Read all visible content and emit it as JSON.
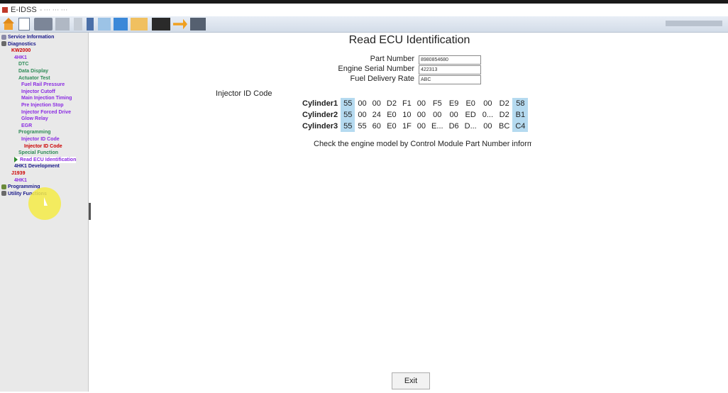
{
  "window": {
    "title": "E-IDSS",
    "title_suffix": "- ··· ··· ···"
  },
  "sidebar": {
    "items": [
      {
        "label": "Service Information",
        "color": "#1a1a8a"
      },
      {
        "label": "Diagnostics",
        "color": "#1a1a8a"
      },
      {
        "label": "KW2000",
        "color": "#cc0000"
      },
      {
        "label": "4HK1",
        "color": "#8a2be2"
      },
      {
        "label": "DTC",
        "color": "#2e8b57"
      },
      {
        "label": "Data Display",
        "color": "#2e8b57"
      },
      {
        "label": "Actuator Test",
        "color": "#2e8b57"
      },
      {
        "label": "Fuel Rail Pressure",
        "color": "#8a2be2"
      },
      {
        "label": "Injector Cutoff",
        "color": "#8a2be2"
      },
      {
        "label": "Main Injection Timing",
        "color": "#8a2be2"
      },
      {
        "label": "Pre Injection Stop",
        "color": "#8a2be2"
      },
      {
        "label": "Injector Forced Drive",
        "color": "#8a2be2"
      },
      {
        "label": "Glow Relay",
        "color": "#8a2be2"
      },
      {
        "label": "EGR",
        "color": "#8a2be2"
      },
      {
        "label": "Programming",
        "color": "#2e8b57"
      },
      {
        "label": "Injector ID Code",
        "color": "#8a2be2"
      },
      {
        "label": "Injector ID Code",
        "color": "#cc0000"
      },
      {
        "label": "Special Function",
        "color": "#2e8b57"
      },
      {
        "label": "Read ECU Identification",
        "color": "#8a2be2"
      },
      {
        "label": "4HK1 Development",
        "color": "#1a1a8a"
      },
      {
        "label": "J1939",
        "color": "#cc0000"
      },
      {
        "label": "4HK1",
        "color": "#8a2be2"
      },
      {
        "label": "Programming",
        "color": "#1a1a8a"
      },
      {
        "label": "Utility Functions",
        "color": "#1a1a8a"
      }
    ]
  },
  "main": {
    "title": "Read ECU Identification",
    "fields": [
      {
        "label": "Part Number",
        "value": "8980854680"
      },
      {
        "label": "Engine Serial Number",
        "value": "422313"
      },
      {
        "label": "Fuel Delivery Rate",
        "value": "ABC"
      }
    ],
    "injector_label": "Injector ID Code",
    "injector_rows": [
      {
        "name": "Cylinder1",
        "codes": [
          "55",
          "00",
          "00",
          "D2",
          "F1",
          "00",
          "F5",
          "E9",
          "E0",
          "00",
          "D2",
          "58"
        ]
      },
      {
        "name": "Cylinder2",
        "codes": [
          "55",
          "00",
          "24",
          "E0",
          "10",
          "00",
          "00",
          "00",
          "ED",
          "0...",
          "D2",
          "B1"
        ]
      },
      {
        "name": "Cylinder3",
        "codes": [
          "55",
          "55",
          "60",
          "E0",
          "1F",
          "00",
          "E...",
          "D6",
          "D...",
          "00",
          "BC",
          "C4"
        ]
      }
    ],
    "note": "Check the engine model by Control Module Part Number information",
    "exit_label": "Exit"
  }
}
